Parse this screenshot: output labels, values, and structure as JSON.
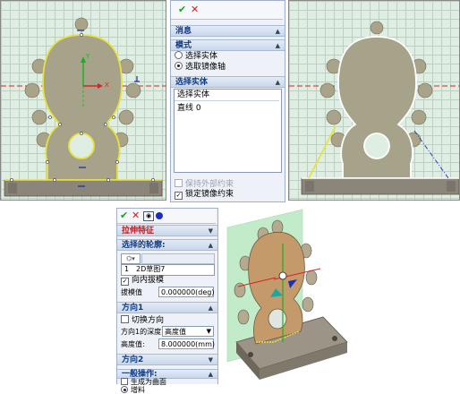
{
  "top_panel": {
    "toolbar": {
      "ok_icon": "check-icon",
      "cancel_icon": "x-icon"
    },
    "sections": {
      "messages": "消息",
      "mode": "模式",
      "select_entity": "选择实体"
    },
    "mode_options": [
      {
        "label": "选择实体",
        "selected": false
      },
      {
        "label": "选取镜像轴",
        "selected": true
      }
    ],
    "entity_list": {
      "header": "选择实体",
      "items": [
        "直线 0"
      ]
    },
    "checkboxes": [
      {
        "label": "保持外部约束",
        "checked": false,
        "disabled": true
      },
      {
        "label": "锁定镜像约束",
        "checked": true,
        "disabled": false
      }
    ]
  },
  "left_view": {
    "axis_label_y": "Y",
    "axis_label_x": "X"
  },
  "bottom_panel": {
    "toolbar": {
      "icons": [
        "check-icon",
        "x-icon",
        "eye-icon",
        "circle-icon"
      ]
    },
    "title": "拉伸特征",
    "profile_section": "选择的轮廓:",
    "profile_list": [
      "2D草图7"
    ],
    "profile_index": "1",
    "draft": {
      "checkbox_label": "向内拔模",
      "checked": true,
      "value_label": "拔模值",
      "value": "0.000000(deg)"
    },
    "direction1": {
      "section": "方向1",
      "toggle_label": "切换方向",
      "toggle_checked": false,
      "depth_label": "方向1的深度",
      "depth_type": "高度值",
      "height_label": "高度值:",
      "height_value": "8.000000(mm)"
    },
    "direction2": {
      "section": "方向2"
    },
    "general": {
      "section": "一般操作:",
      "options": [
        {
          "label": "生成为曲面",
          "kind": "checkbox",
          "checked": false
        },
        {
          "label": "增料",
          "kind": "radio",
          "checked": true
        }
      ]
    }
  }
}
